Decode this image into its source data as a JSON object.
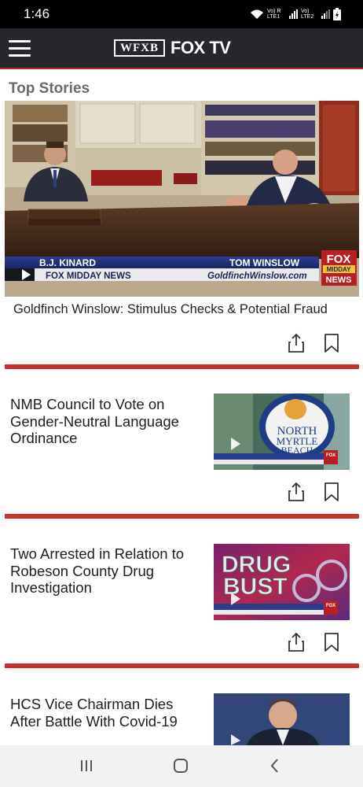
{
  "status_bar": {
    "time": "1:46",
    "network_label_1": "Vo) R LTE1",
    "network_label_2": "Vo) LTE2"
  },
  "header": {
    "logo_station": "WFXB",
    "logo_brand": "FOX TV",
    "accent_color": "#c8201f"
  },
  "section_title": "Top Stories",
  "hero": {
    "title": "Goldfinch Winslow: Stimulus Checks & Potential Fraud",
    "lower_third": {
      "left_name": "B.J. KINARD",
      "right_name": "TOM WINSLOW",
      "show": "FOX MIDDAY NEWS",
      "website": "GoldfinchWinslow.com",
      "bug_top": "FOX",
      "bug_middle": "MIDDAY",
      "bug_bottom": "NEWS"
    }
  },
  "stories": [
    {
      "title": "NMB Council to Vote on Gender-Neutral Language Ordinance",
      "thumb_text_1": "NORTH",
      "thumb_text_2": "MYRTLE",
      "thumb_text_3": "BEACH",
      "thumb_bug": "FOX"
    },
    {
      "title": "Two Arrested in Relation to Robeson County Drug Investigation",
      "thumb_text_1": "DRUG",
      "thumb_text_2": "BUST",
      "thumb_bug": "FOX"
    },
    {
      "title": "HCS Vice Chairman Dies After Battle With Covid-19"
    }
  ],
  "icons": {
    "share": "share-icon",
    "bookmark": "bookmark-icon",
    "menu": "hamburger-menu-icon",
    "play": "play-icon"
  }
}
